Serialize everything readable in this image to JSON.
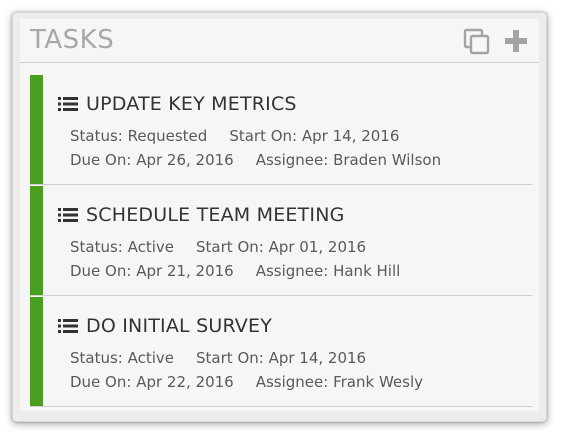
{
  "panel": {
    "title": "TASKS",
    "copy_icon": "copy-icon",
    "add_icon": "plus-icon",
    "accent_color": "#4a9e1f"
  },
  "tasks": [
    {
      "name": "UPDATE KEY METRICS",
      "status": "Status: Requested",
      "start": "Start On: Apr 14, 2016",
      "due": "Due On: Apr 26, 2016",
      "assignee": "Assignee: Braden Wilson"
    },
    {
      "name": "SCHEDULE TEAM MEETING",
      "status": "Status: Active",
      "start": "Start On: Apr 01, 2016",
      "due": "Due On: Apr 21, 2016",
      "assignee": "Assignee: Hank Hill"
    },
    {
      "name": "DO INITIAL SURVEY",
      "status": "Status: Active",
      "start": "Start On: Apr 14, 2016",
      "due": "Due On: Apr 22, 2016",
      "assignee": "Assignee: Frank Wesly"
    }
  ]
}
